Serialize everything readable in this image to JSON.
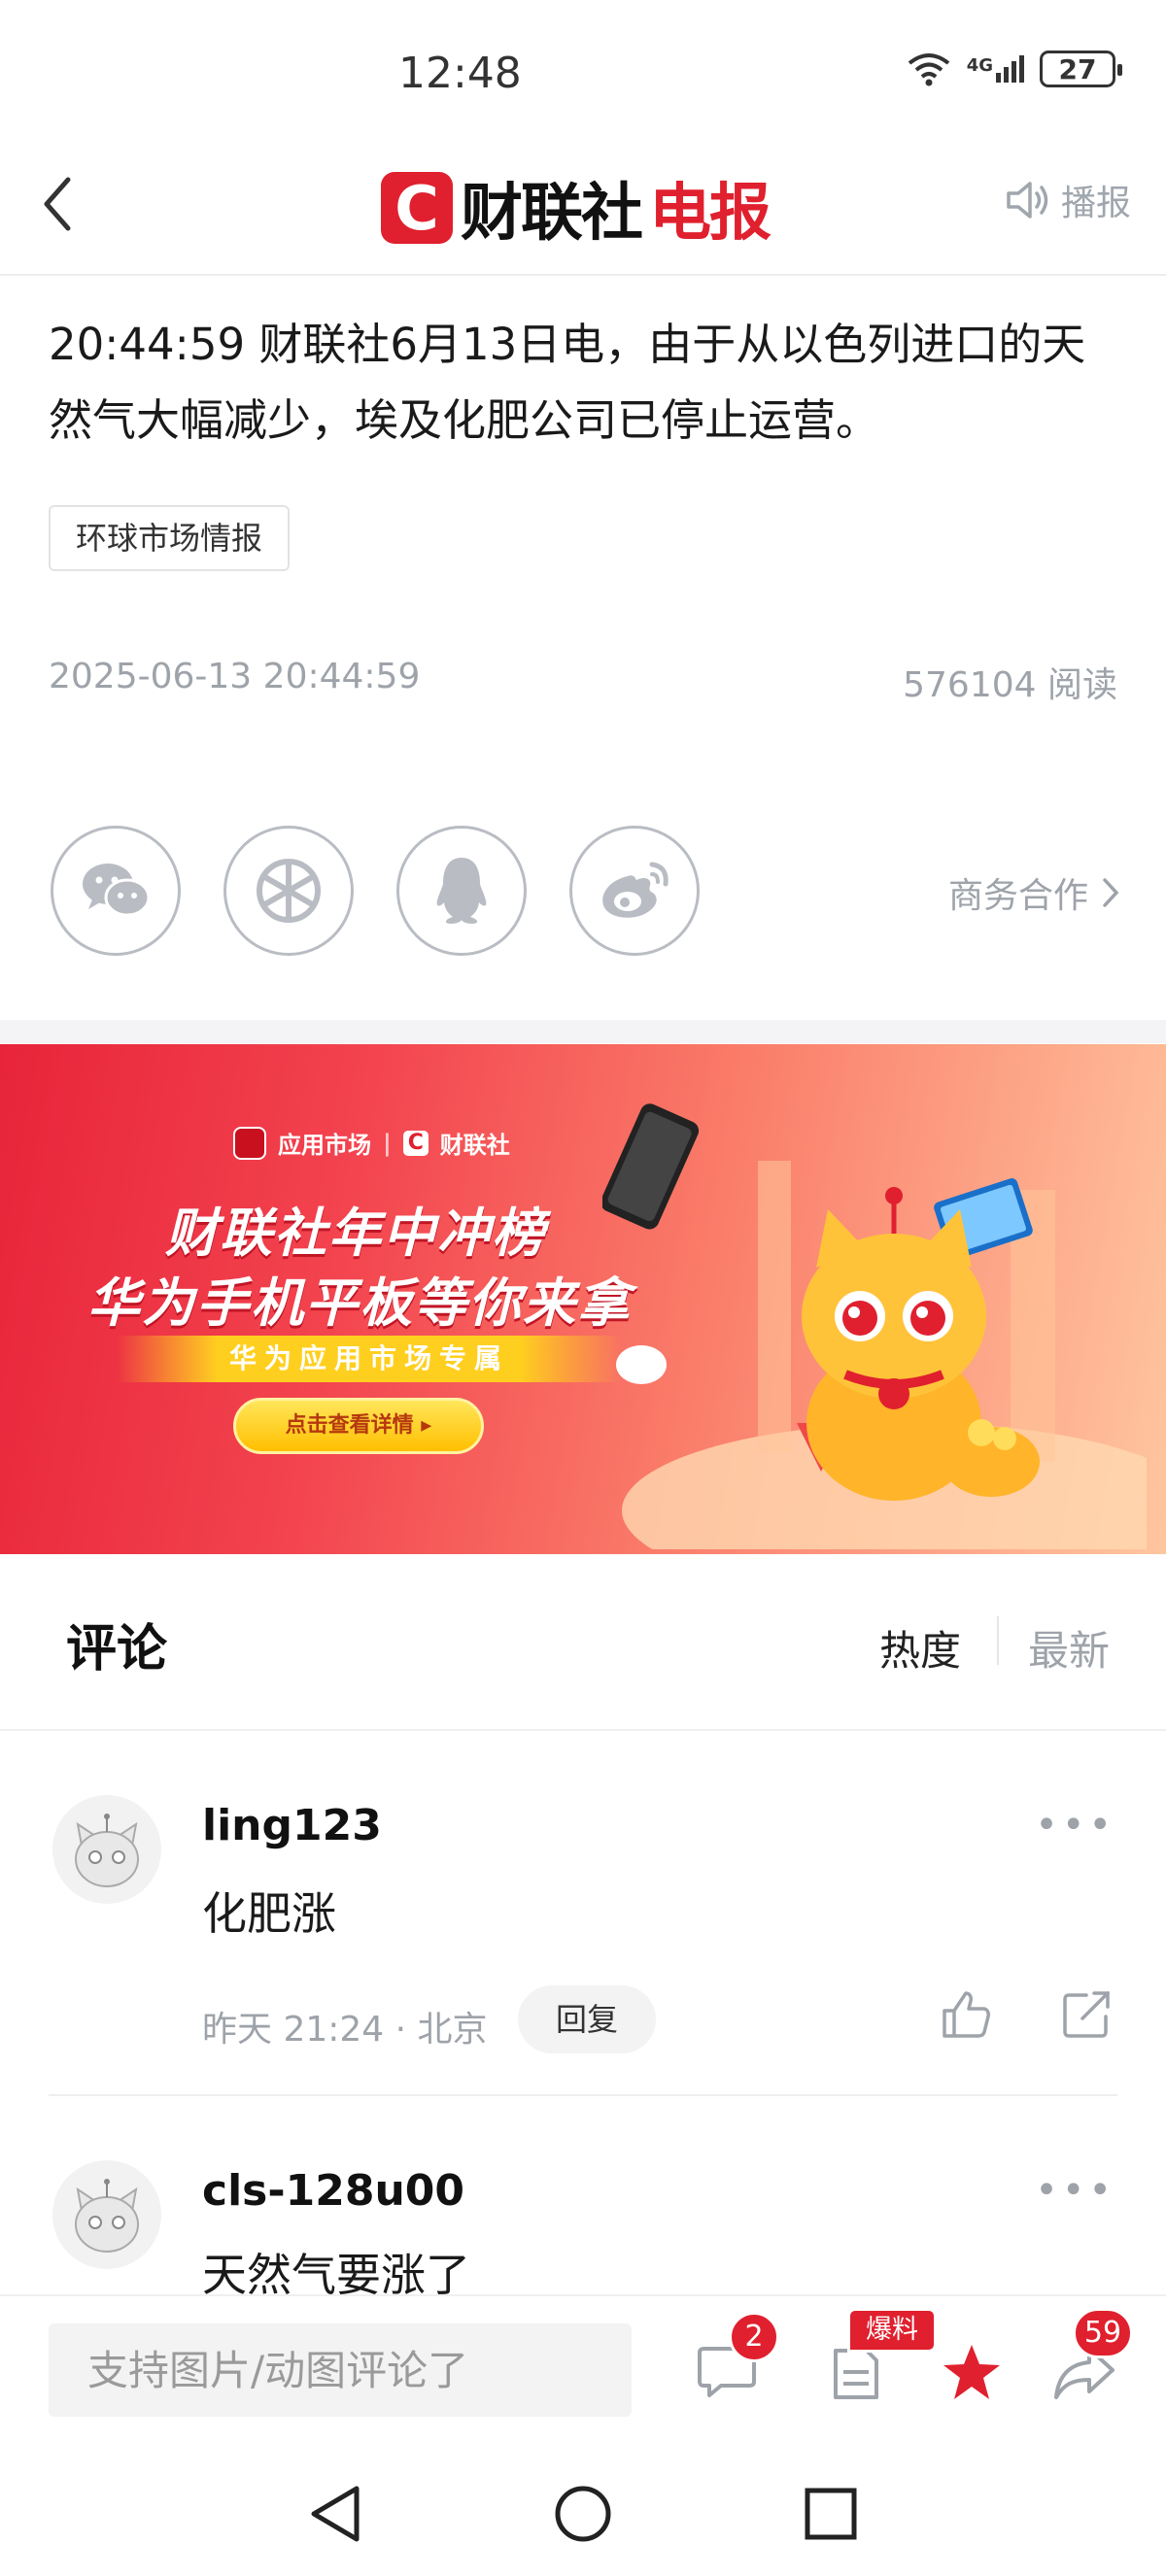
{
  "status_bar": {
    "time": "12:48",
    "network": "4G",
    "battery": "27"
  },
  "header": {
    "logo_letter": "C",
    "logo_part1": "财联社",
    "logo_part2": "电报",
    "broadcast_label": "播报"
  },
  "article": {
    "body": "20:44:59  财联社6月13日电，由于从以色列进口的天然气大幅减少，埃及化肥公司已停止运营。",
    "tag": "环球市场情报",
    "date": "2025-06-13 20:44:59",
    "read_count": "576104 阅读",
    "business_link": "商务合作"
  },
  "share": [
    {
      "name": "wechat-icon"
    },
    {
      "name": "moments-icon"
    },
    {
      "name": "qq-icon"
    },
    {
      "name": "weibo-icon"
    }
  ],
  "banner": {
    "brand_app": "应用市场",
    "brand_name": "财联社",
    "line1": "财联社年中冲榜",
    "line2": "华为手机平板等你来拿",
    "strip": "华为应用市场专属",
    "button": "点击查看详情 ▸",
    "colors": {
      "start": "#e8243a",
      "end": "#ffc6a0"
    }
  },
  "comments_section": {
    "title": "评论",
    "sort_hot": "热度",
    "sort_new": "最新",
    "items": [
      {
        "user": "ling123",
        "text": "化肥涨",
        "meta": "昨天 21:24 · 北京",
        "reply": "回复"
      },
      {
        "user": "cls-128u00",
        "text": "天然气要涨了"
      }
    ]
  },
  "bottom_bar": {
    "input_placeholder": "支持图片/动图评论了",
    "comment_count": "2",
    "report_badge": "爆料",
    "share_count": "59"
  },
  "accent_color": "#e0202e"
}
